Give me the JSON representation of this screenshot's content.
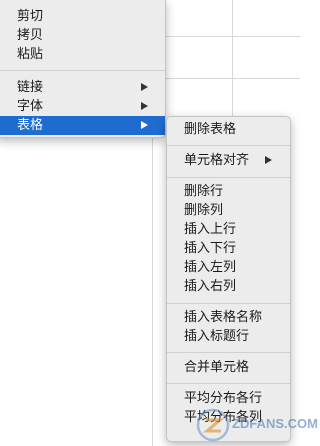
{
  "context_menu": {
    "items": [
      {
        "label": "剪切"
      },
      {
        "label": "拷贝"
      },
      {
        "label": "粘贴"
      },
      {
        "label": "链接"
      },
      {
        "label": "字体"
      },
      {
        "label": "表格"
      }
    ]
  },
  "table_submenu": {
    "items": [
      {
        "label": "删除表格"
      },
      {
        "label": "单元格对齐"
      },
      {
        "label": "删除行"
      },
      {
        "label": "删除列"
      },
      {
        "label": "插入上行"
      },
      {
        "label": "插入下行"
      },
      {
        "label": "插入左列"
      },
      {
        "label": "插入右列"
      },
      {
        "label": "插入表格名称"
      },
      {
        "label": "插入标题行"
      },
      {
        "label": "合并单元格"
      },
      {
        "label": "平均分布各行"
      },
      {
        "label": "平均分布各列"
      }
    ]
  },
  "watermark": {
    "text": "ZDFANS.COM"
  },
  "colors": {
    "selection": "#1e6ccf",
    "menu_bg": "#ececec",
    "grid": "#d8d8d8"
  },
  "icons": {
    "submenu": "chevron-right-icon",
    "watermark_logo": "zdfans-logo-icon"
  }
}
